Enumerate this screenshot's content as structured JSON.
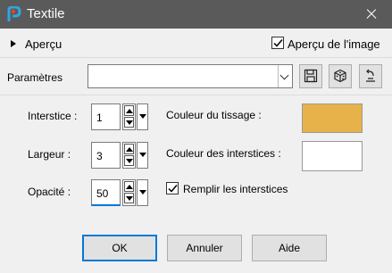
{
  "window": {
    "title": "Textile",
    "app_icon": "paintshop-pro-icon",
    "close_icon": "close-icon"
  },
  "preview": {
    "toggle_label": "Aperçu",
    "image_preview_label": "Aperçu de l'image",
    "image_preview_checked": true
  },
  "parameters": {
    "label": "Paramètres",
    "preset_value": "",
    "save_icon": "save-icon",
    "random_icon": "dice-icon",
    "reset_icon": "reset-icon"
  },
  "fields": {
    "interstice": {
      "label": "Interstice :",
      "value": "1"
    },
    "largeur": {
      "label": "Largeur :",
      "value": "3"
    },
    "opacite": {
      "label": "Opacité :",
      "value": "50"
    }
  },
  "colors": {
    "weave_label": "Couleur du tissage :",
    "weave_color": "#E8B24A",
    "gap_label": "Couleur des interstices :",
    "gap_color": "#FFFFFF"
  },
  "fill_gaps": {
    "label": "Remplir les interstices",
    "checked": true
  },
  "buttons": {
    "ok": "OK",
    "cancel": "Annuler",
    "help": "Aide"
  }
}
